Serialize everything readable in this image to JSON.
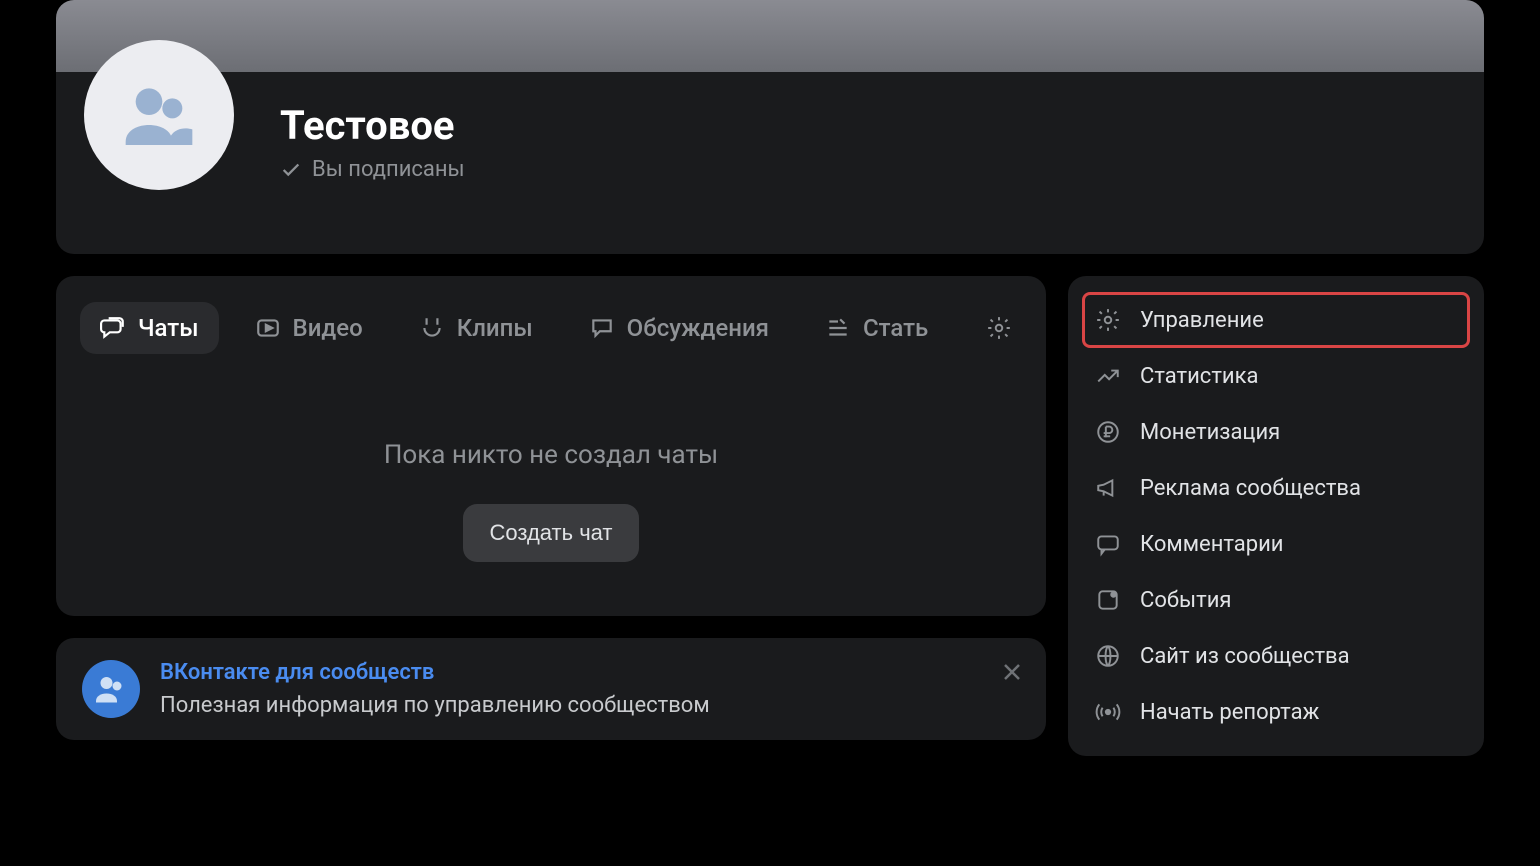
{
  "header": {
    "title": "Тестовое",
    "subscribed_label": "Вы подписаны"
  },
  "tabs": [
    {
      "id": "chats",
      "label": "Чаты",
      "icon": "chat-bubble-icon",
      "active": true
    },
    {
      "id": "video",
      "label": "Видео",
      "icon": "play-circle-icon",
      "active": false
    },
    {
      "id": "clips",
      "label": "Клипы",
      "icon": "clips-icon",
      "active": false
    },
    {
      "id": "discussions",
      "label": "Обсуждения",
      "icon": "speech-icon",
      "active": false
    },
    {
      "id": "articles",
      "label": "Стать",
      "icon": "article-icon",
      "active": false
    }
  ],
  "content": {
    "empty_text": "Пока никто не создал чаты",
    "create_button": "Создать чат"
  },
  "promo": {
    "title": "ВКонтакте для сообществ",
    "subtitle": "Полезная информация по управлению сообществом"
  },
  "menu": [
    {
      "id": "manage",
      "label": "Управление",
      "icon": "gear-icon",
      "highlight": true
    },
    {
      "id": "stats",
      "label": "Статистика",
      "icon": "stats-icon",
      "highlight": false
    },
    {
      "id": "monetize",
      "label": "Монетизация",
      "icon": "ruble-icon",
      "highlight": false
    },
    {
      "id": "ads",
      "label": "Реклама сообщества",
      "icon": "megaphone-icon",
      "highlight": false
    },
    {
      "id": "comments",
      "label": "Комментарии",
      "icon": "comment-icon",
      "highlight": false
    },
    {
      "id": "events",
      "label": "События",
      "icon": "event-icon",
      "highlight": false
    },
    {
      "id": "site",
      "label": "Сайт из сообщества",
      "icon": "globe-icon",
      "highlight": false
    },
    {
      "id": "live",
      "label": "Начать репортаж",
      "icon": "broadcast-icon",
      "highlight": false
    }
  ]
}
